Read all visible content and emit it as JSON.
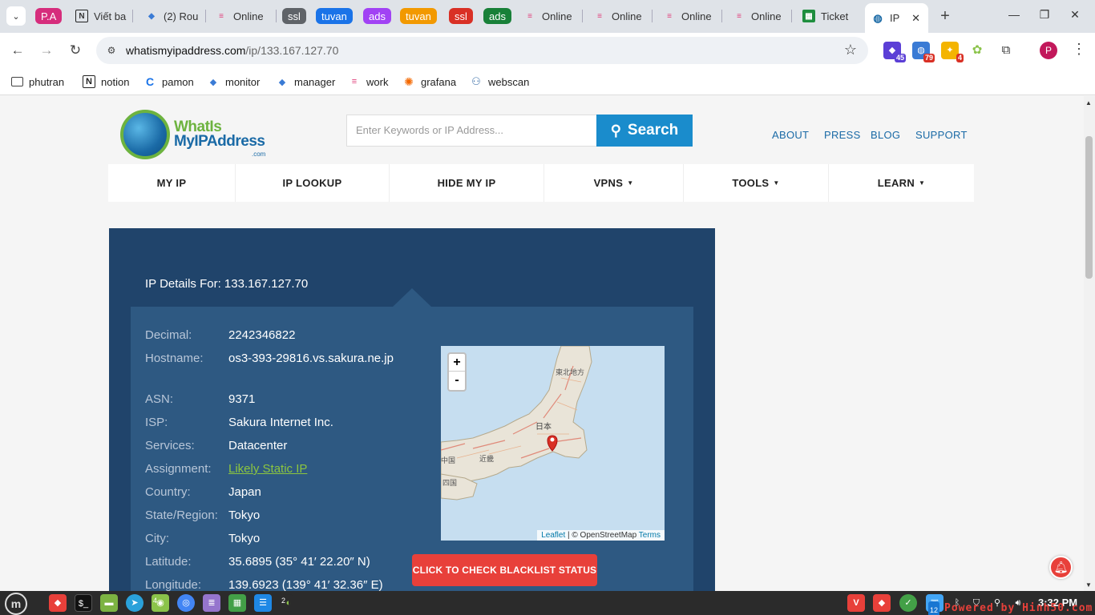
{
  "browser": {
    "tabs": [
      {
        "label": "P.A",
        "kind": "group",
        "color": "#d62d7c"
      },
      {
        "label": "Viết ba",
        "kind": "tab",
        "icon": "notion-icon"
      },
      {
        "label": "(2) Rou",
        "kind": "tab",
        "icon": "cube-icon"
      },
      {
        "label": "Online",
        "kind": "tab",
        "icon": "c-logo-icon"
      },
      {
        "label": "ssl",
        "kind": "group",
        "color": "#5f6368"
      },
      {
        "label": "tuvan",
        "kind": "group",
        "color": "#1a73e8"
      },
      {
        "label": "ads",
        "kind": "group",
        "color": "#a142f4"
      },
      {
        "label": "tuvan",
        "kind": "group",
        "color": "#f29900"
      },
      {
        "label": "ssl",
        "kind": "group",
        "color": "#d93025"
      },
      {
        "label": "ads",
        "kind": "group",
        "color": "#188038"
      },
      {
        "label": "Online",
        "kind": "tab",
        "icon": "c-logo-icon"
      },
      {
        "label": "Online",
        "kind": "tab",
        "icon": "c-logo-icon"
      },
      {
        "label": "Online",
        "kind": "tab",
        "icon": "c-logo-icon"
      },
      {
        "label": "Online",
        "kind": "tab",
        "icon": "c-logo-icon"
      },
      {
        "label": "Ticket",
        "kind": "tab",
        "icon": "sheets-icon"
      },
      {
        "label": "IP",
        "kind": "active",
        "icon": "globe-icon"
      }
    ],
    "address": {
      "host": "whatismyipaddress.com",
      "path": "/ip/133.167.127.70"
    },
    "extensions": [
      {
        "icon": "ext-shield-icon",
        "badge": "45",
        "color": "#5b3fd6",
        "badge_color": "#5b3fd6"
      },
      {
        "icon": "ext-globe-icon",
        "badge": "79",
        "color": "#3a7bd5",
        "badge_color": "#d93025"
      },
      {
        "icon": "ext-bulb-icon",
        "badge": "4",
        "color": "#f4b400",
        "badge_color": "#d93025"
      },
      {
        "icon": "ext-gear-icon",
        "badge": "",
        "color": "#8bc34a",
        "badge_color": ""
      },
      {
        "icon": "extensions-puzzle-icon",
        "badge": "",
        "color": "#ffffff",
        "badge_color": ""
      }
    ],
    "profile_initial": "P",
    "bookmarks": [
      {
        "label": "phutran",
        "icon": "folder-icon"
      },
      {
        "label": "notion",
        "icon": "notion-icon"
      },
      {
        "label": "pamon",
        "icon": "pamon-icon"
      },
      {
        "label": "monitor",
        "icon": "cube-icon"
      },
      {
        "label": "manager",
        "icon": "cube-icon"
      },
      {
        "label": "work",
        "icon": "c-logo-icon"
      },
      {
        "label": "grafana",
        "icon": "grafana-icon"
      },
      {
        "label": "webscan",
        "icon": "webscan-icon"
      }
    ]
  },
  "site": {
    "logo": {
      "line1": "WhatIs",
      "line2": "MyIPAddress",
      "suffix": ".com"
    },
    "search": {
      "placeholder": "Enter Keywords or IP Address...",
      "button": "Search"
    },
    "top_links": [
      "ABOUT",
      "PRESS",
      "BLOG",
      "SUPPORT"
    ],
    "main_nav": [
      {
        "label": "MY IP",
        "dropdown": false
      },
      {
        "label": "IP LOOKUP",
        "dropdown": false
      },
      {
        "label": "HIDE MY IP",
        "dropdown": false
      },
      {
        "label": "VPNS",
        "dropdown": true
      },
      {
        "label": "TOOLS",
        "dropdown": true
      },
      {
        "label": "LEARN",
        "dropdown": true
      }
    ],
    "caret": "▼",
    "details_title": "IP Details For: 133.167.127.70",
    "details": [
      {
        "key": "Decimal:",
        "value": "2242346822"
      },
      {
        "key": "Hostname:",
        "value": "os3-393-29816.vs.sakura.ne.jp"
      },
      {
        "key": "ASN:",
        "value": "9371"
      },
      {
        "key": "ISP:",
        "value": "Sakura Internet Inc."
      },
      {
        "key": "Services:",
        "value": "Datacenter"
      },
      {
        "key": "Assignment:",
        "value": "Likely Static IP",
        "link": true
      },
      {
        "key": "Country:",
        "value": "Japan"
      },
      {
        "key": "State/Region:",
        "value": "Tokyo"
      },
      {
        "key": "City:",
        "value": "Tokyo"
      },
      {
        "key": "Latitude:",
        "value": "35.6895 (35° 41′ 22.20″ N)"
      },
      {
        "key": "Longitude:",
        "value": "139.6923 (139° 41′ 32.36″ E)"
      }
    ],
    "map": {
      "zoom_in": "+",
      "zoom_out": "-",
      "attrib_leaflet": "Leaflet",
      "attrib_sep": "| © OpenStreetMap",
      "attrib_terms": "Terms",
      "labels": [
        "東北地方",
        "日本",
        "近畿",
        "中国",
        "四国"
      ]
    },
    "blacklist_button": "CLICK TO CHECK BLACKLIST STATUS"
  },
  "taskbar": {
    "clock": "3:32 PM",
    "watermark": "Powered by Hinh50.com",
    "badges": {
      "chrome": "4",
      "app": "2",
      "tray": "12"
    }
  }
}
